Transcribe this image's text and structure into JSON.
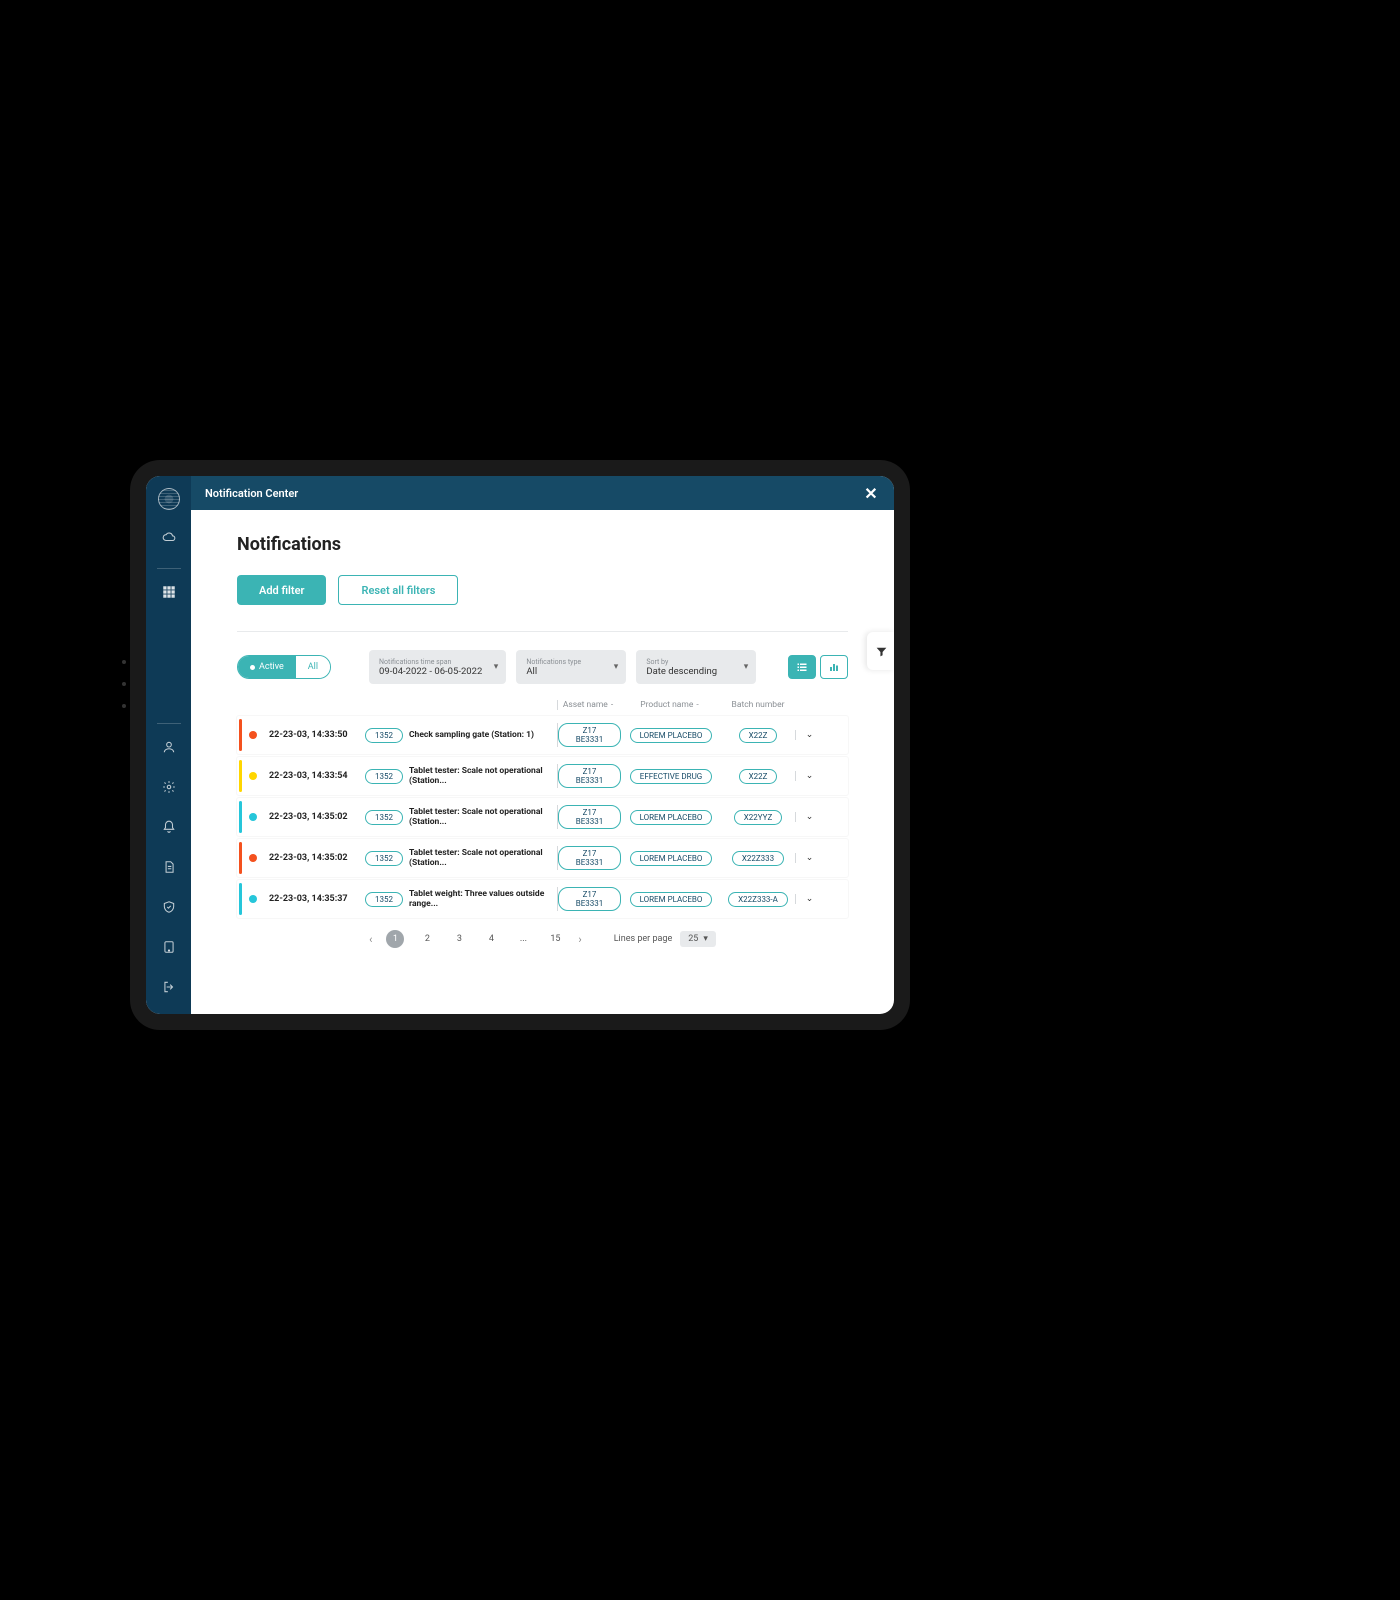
{
  "header": {
    "title": "Notification Center"
  },
  "page": {
    "title": "Notifications"
  },
  "buttons": {
    "add_filter": "Add filter",
    "reset_filters": "Reset all filters"
  },
  "toggle": {
    "active": "Active",
    "all": "All"
  },
  "filters": {
    "timespan_label": "Notifications time span",
    "timespan_value": "09-04-2022 - 06-05-2022",
    "type_label": "Notifications type",
    "type_value": "All",
    "sort_label": "Sort by",
    "sort_value": "Date descending"
  },
  "columns": {
    "asset": "Asset name",
    "product": "Product name",
    "batch": "Batch number",
    "sep": "-"
  },
  "colors": {
    "orange": "#f4511e",
    "yellow": "#ffd600",
    "cyan": "#26c6da"
  },
  "rows": [
    {
      "color": "orange",
      "time": "22-23-03, 14:33:50",
      "code": "1352",
      "msg": "Check sampling gate (Station: 1)",
      "asset": "Z17 BE3331",
      "product": "LOREM PLACEBO",
      "batch": "X22Z"
    },
    {
      "color": "yellow",
      "time": "22-23-03, 14:33:54",
      "code": "1352",
      "msg": "Tablet tester: Scale not operational (Station...",
      "asset": "Z17 BE3331",
      "product": "EFFECTIVE DRUG",
      "batch": "X22Z"
    },
    {
      "color": "cyan",
      "time": "22-23-03, 14:35:02",
      "code": "1352",
      "msg": "Tablet tester: Scale not operational (Station...",
      "asset": "Z17 BE3331",
      "product": "LOREM PLACEBO",
      "batch": "X22YYZ"
    },
    {
      "color": "orange",
      "time": "22-23-03, 14:35:02",
      "code": "1352",
      "msg": "Tablet tester: Scale not operational (Station...",
      "asset": "Z17 BE3331",
      "product": "LOREM PLACEBO",
      "batch": "X22Z333"
    },
    {
      "color": "cyan",
      "time": "22-23-03, 14:35:37",
      "code": "1352",
      "msg": "Tablet weight: Three values outside range...",
      "asset": "Z17 BE3331",
      "product": "LOREM PLACEBO",
      "batch": "X22Z333-A"
    }
  ],
  "pagination": {
    "pages": [
      "1",
      "2",
      "3",
      "4",
      "...",
      "15"
    ],
    "active": "1",
    "lpp_label": "Lines per page",
    "lpp_value": "25"
  }
}
